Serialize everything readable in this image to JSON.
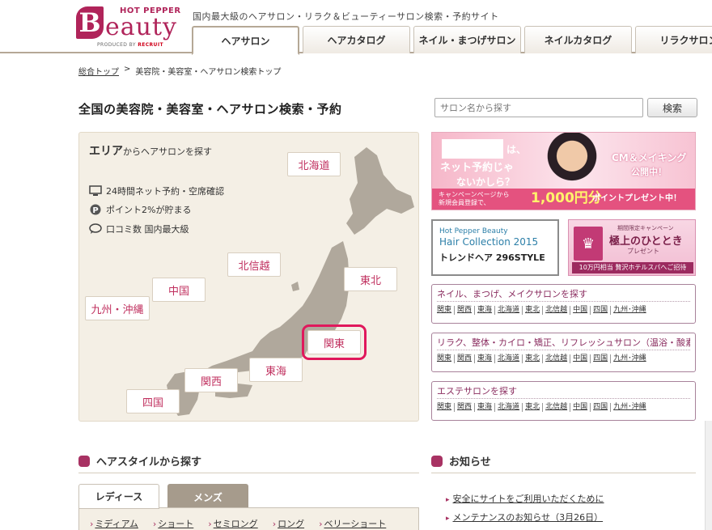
{
  "header": {
    "logo": {
      "top": "HOT PEPPER",
      "letter": "B",
      "word": "eauty",
      "sub_prefix": "PRODUCED BY ",
      "sub_brand": "RECRUIT"
    },
    "tagline": "国内最大級のヘアサロン・リラク＆ビューティーサロン検索・予約サイト",
    "tabs": [
      "ヘアサロン",
      "ヘアカタログ",
      "ネイル・まつげサロン",
      "ネイルカタログ",
      "リラクサロン"
    ]
  },
  "breadcrumb": {
    "home": "総合トップ",
    "sep": ">",
    "current": "美容院・美容室・ヘアサロン検索トップ"
  },
  "page_title": "全国の美容院・美容室・ヘアサロン検索・予約",
  "search": {
    "placeholder": "サロン名から探す",
    "button": "検索"
  },
  "area": {
    "heading_bold": "エリア",
    "heading_rest": "からヘアサロンを探す",
    "features": [
      {
        "icon": "monitor-icon",
        "text": "24時間ネット予約・空席確認"
      },
      {
        "icon": "point-icon",
        "text": "ポイント2%が貯まる"
      },
      {
        "icon": "speech-bubble-icon",
        "text": "口コミ数 国内最大級"
      }
    ],
    "regions": [
      "北海道",
      "東北",
      "北信越",
      "中国",
      "九州・沖縄",
      "関東",
      "関西",
      "東海",
      "四国"
    ],
    "highlighted": "関東",
    "map_color": "#b0a89c"
  },
  "banners": {
    "promo": {
      "ha": "は、",
      "question_1": "ネット予約じゃ",
      "question_2": "ないかしら？",
      "cm_1": "CM＆メイキング",
      "cm_2": "公開中！",
      "bar_1": "キャンペーンページから",
      "bar_2": "新規会員登録で、",
      "amount": "1,000円分",
      "bar_rest": "ポイントプレゼント中！"
    },
    "hair_collection": {
      "l1": "Hot Pepper Beauty",
      "l2": "Hair Collection 2015",
      "l3": "トレンドヘア 296STYLE"
    },
    "campaign": {
      "crown": "♛",
      "l1": "期間限定キャンペーン",
      "l2": "極上のひととき",
      "l3": "プレゼント",
      "l4": "10万円相当 贅沢ホテルスパへご招待"
    }
  },
  "categories": [
    {
      "title": "ネイル、まつげ、メイクサロンを探す"
    },
    {
      "title": "リラク、整体・カイロ・矯正、リフレッシュサロン（温浴・酸素）サロンを探す"
    },
    {
      "title": "エステサロンを探す"
    }
  ],
  "category_links": [
    "関東",
    "関西",
    "東海",
    "北海道",
    "東北",
    "北信越",
    "中国",
    "四国",
    "九州･沖縄"
  ],
  "hairstyle": {
    "heading": "ヘアスタイルから探す",
    "tabs": [
      "レディース",
      "メンズ"
    ],
    "links": [
      "ミディアム",
      "ショート",
      "セミロング",
      "ロング",
      "ベリーショート"
    ]
  },
  "news": {
    "heading": "お知らせ",
    "items": [
      "安全にサイトをご利用いただくために",
      "メンテナンスのお知らせ（3月26日）"
    ]
  },
  "colors": {
    "brand": "#b0245a",
    "accent_border": "#e0185c",
    "panel_bg": "#f4efe5"
  }
}
